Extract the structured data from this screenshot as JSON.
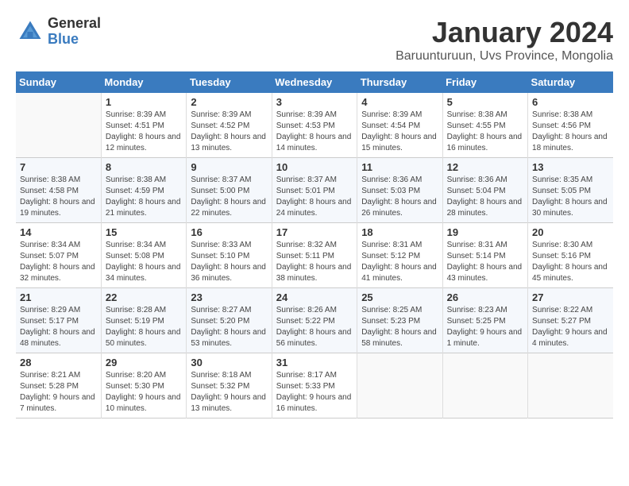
{
  "logo": {
    "general": "General",
    "blue": "Blue"
  },
  "title": "January 2024",
  "subtitle": "Baruunturuun, Uvs Province, Mongolia",
  "days_of_week": [
    "Sunday",
    "Monday",
    "Tuesday",
    "Wednesday",
    "Thursday",
    "Friday",
    "Saturday"
  ],
  "weeks": [
    [
      {
        "day": "",
        "sunrise": "",
        "sunset": "",
        "daylight": ""
      },
      {
        "day": "1",
        "sunrise": "Sunrise: 8:39 AM",
        "sunset": "Sunset: 4:51 PM",
        "daylight": "Daylight: 8 hours and 12 minutes."
      },
      {
        "day": "2",
        "sunrise": "Sunrise: 8:39 AM",
        "sunset": "Sunset: 4:52 PM",
        "daylight": "Daylight: 8 hours and 13 minutes."
      },
      {
        "day": "3",
        "sunrise": "Sunrise: 8:39 AM",
        "sunset": "Sunset: 4:53 PM",
        "daylight": "Daylight: 8 hours and 14 minutes."
      },
      {
        "day": "4",
        "sunrise": "Sunrise: 8:39 AM",
        "sunset": "Sunset: 4:54 PM",
        "daylight": "Daylight: 8 hours and 15 minutes."
      },
      {
        "day": "5",
        "sunrise": "Sunrise: 8:38 AM",
        "sunset": "Sunset: 4:55 PM",
        "daylight": "Daylight: 8 hours and 16 minutes."
      },
      {
        "day": "6",
        "sunrise": "Sunrise: 8:38 AM",
        "sunset": "Sunset: 4:56 PM",
        "daylight": "Daylight: 8 hours and 18 minutes."
      }
    ],
    [
      {
        "day": "7",
        "sunrise": "Sunrise: 8:38 AM",
        "sunset": "Sunset: 4:58 PM",
        "daylight": "Daylight: 8 hours and 19 minutes."
      },
      {
        "day": "8",
        "sunrise": "Sunrise: 8:38 AM",
        "sunset": "Sunset: 4:59 PM",
        "daylight": "Daylight: 8 hours and 21 minutes."
      },
      {
        "day": "9",
        "sunrise": "Sunrise: 8:37 AM",
        "sunset": "Sunset: 5:00 PM",
        "daylight": "Daylight: 8 hours and 22 minutes."
      },
      {
        "day": "10",
        "sunrise": "Sunrise: 8:37 AM",
        "sunset": "Sunset: 5:01 PM",
        "daylight": "Daylight: 8 hours and 24 minutes."
      },
      {
        "day": "11",
        "sunrise": "Sunrise: 8:36 AM",
        "sunset": "Sunset: 5:03 PM",
        "daylight": "Daylight: 8 hours and 26 minutes."
      },
      {
        "day": "12",
        "sunrise": "Sunrise: 8:36 AM",
        "sunset": "Sunset: 5:04 PM",
        "daylight": "Daylight: 8 hours and 28 minutes."
      },
      {
        "day": "13",
        "sunrise": "Sunrise: 8:35 AM",
        "sunset": "Sunset: 5:05 PM",
        "daylight": "Daylight: 8 hours and 30 minutes."
      }
    ],
    [
      {
        "day": "14",
        "sunrise": "Sunrise: 8:34 AM",
        "sunset": "Sunset: 5:07 PM",
        "daylight": "Daylight: 8 hours and 32 minutes."
      },
      {
        "day": "15",
        "sunrise": "Sunrise: 8:34 AM",
        "sunset": "Sunset: 5:08 PM",
        "daylight": "Daylight: 8 hours and 34 minutes."
      },
      {
        "day": "16",
        "sunrise": "Sunrise: 8:33 AM",
        "sunset": "Sunset: 5:10 PM",
        "daylight": "Daylight: 8 hours and 36 minutes."
      },
      {
        "day": "17",
        "sunrise": "Sunrise: 8:32 AM",
        "sunset": "Sunset: 5:11 PM",
        "daylight": "Daylight: 8 hours and 38 minutes."
      },
      {
        "day": "18",
        "sunrise": "Sunrise: 8:31 AM",
        "sunset": "Sunset: 5:12 PM",
        "daylight": "Daylight: 8 hours and 41 minutes."
      },
      {
        "day": "19",
        "sunrise": "Sunrise: 8:31 AM",
        "sunset": "Sunset: 5:14 PM",
        "daylight": "Daylight: 8 hours and 43 minutes."
      },
      {
        "day": "20",
        "sunrise": "Sunrise: 8:30 AM",
        "sunset": "Sunset: 5:16 PM",
        "daylight": "Daylight: 8 hours and 45 minutes."
      }
    ],
    [
      {
        "day": "21",
        "sunrise": "Sunrise: 8:29 AM",
        "sunset": "Sunset: 5:17 PM",
        "daylight": "Daylight: 8 hours and 48 minutes."
      },
      {
        "day": "22",
        "sunrise": "Sunrise: 8:28 AM",
        "sunset": "Sunset: 5:19 PM",
        "daylight": "Daylight: 8 hours and 50 minutes."
      },
      {
        "day": "23",
        "sunrise": "Sunrise: 8:27 AM",
        "sunset": "Sunset: 5:20 PM",
        "daylight": "Daylight: 8 hours and 53 minutes."
      },
      {
        "day": "24",
        "sunrise": "Sunrise: 8:26 AM",
        "sunset": "Sunset: 5:22 PM",
        "daylight": "Daylight: 8 hours and 56 minutes."
      },
      {
        "day": "25",
        "sunrise": "Sunrise: 8:25 AM",
        "sunset": "Sunset: 5:23 PM",
        "daylight": "Daylight: 8 hours and 58 minutes."
      },
      {
        "day": "26",
        "sunrise": "Sunrise: 8:23 AM",
        "sunset": "Sunset: 5:25 PM",
        "daylight": "Daylight: 9 hours and 1 minute."
      },
      {
        "day": "27",
        "sunrise": "Sunrise: 8:22 AM",
        "sunset": "Sunset: 5:27 PM",
        "daylight": "Daylight: 9 hours and 4 minutes."
      }
    ],
    [
      {
        "day": "28",
        "sunrise": "Sunrise: 8:21 AM",
        "sunset": "Sunset: 5:28 PM",
        "daylight": "Daylight: 9 hours and 7 minutes."
      },
      {
        "day": "29",
        "sunrise": "Sunrise: 8:20 AM",
        "sunset": "Sunset: 5:30 PM",
        "daylight": "Daylight: 9 hours and 10 minutes."
      },
      {
        "day": "30",
        "sunrise": "Sunrise: 8:18 AM",
        "sunset": "Sunset: 5:32 PM",
        "daylight": "Daylight: 9 hours and 13 minutes."
      },
      {
        "day": "31",
        "sunrise": "Sunrise: 8:17 AM",
        "sunset": "Sunset: 5:33 PM",
        "daylight": "Daylight: 9 hours and 16 minutes."
      },
      {
        "day": "",
        "sunrise": "",
        "sunset": "",
        "daylight": ""
      },
      {
        "day": "",
        "sunrise": "",
        "sunset": "",
        "daylight": ""
      },
      {
        "day": "",
        "sunrise": "",
        "sunset": "",
        "daylight": ""
      }
    ]
  ]
}
